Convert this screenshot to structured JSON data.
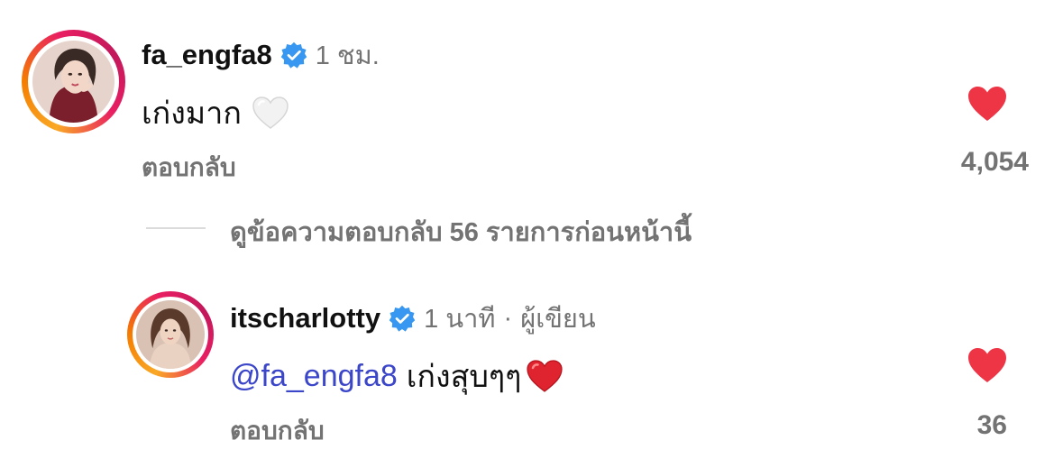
{
  "comments": [
    {
      "username": "fa_engfa8",
      "time": "1 ชม.",
      "text": "เก่งมาก",
      "emoji_icon": "white-heart-icon",
      "reply_label": "ตอบกลับ",
      "likes": "4,054",
      "like_icon": "heart-icon",
      "liked": true
    },
    {
      "username": "itscharlotty",
      "time": "1 นาที",
      "separator": "·",
      "author_tag": "ผู้เขียน",
      "mention": "@fa_engfa8",
      "text": "เก่งสุบๆๆ",
      "emoji_icon": "red-heart-icon",
      "reply_label": "ตอบกลับ",
      "likes": "36",
      "like_icon": "heart-icon",
      "liked": true
    }
  ],
  "view_replies": "ดูข้อความตอบกลับ 56 รายการก่อนหน้านี้",
  "colors": {
    "verified": "#3897f0",
    "like": "#ed4956",
    "mention": "#3b46c9",
    "secondary_text": "#737373"
  }
}
